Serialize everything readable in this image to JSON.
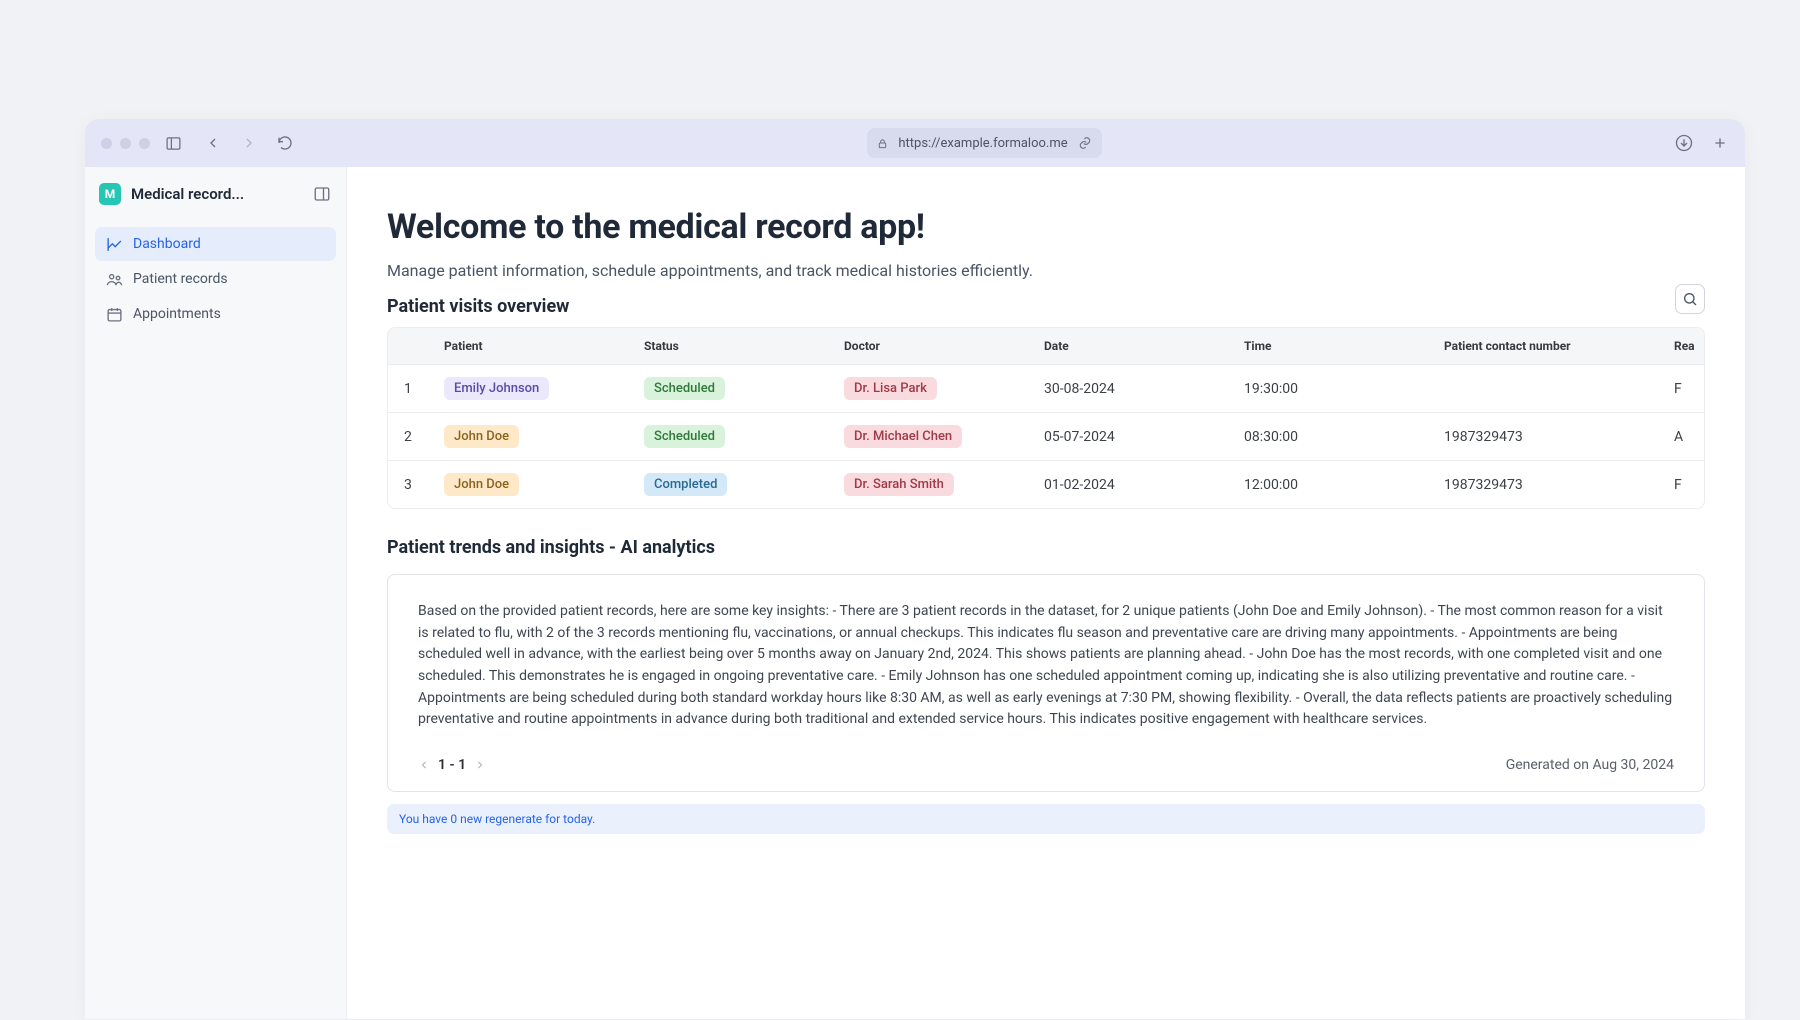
{
  "toolbar": {
    "url": "https://example.formaloo.me"
  },
  "sidebar": {
    "app_initial": "M",
    "app_title": "Medical record...",
    "items": [
      {
        "label": "Dashboard"
      },
      {
        "label": "Patient records"
      },
      {
        "label": "Appointments"
      }
    ]
  },
  "main": {
    "title": "Welcome to the medical record app!",
    "subtitle": "Manage patient information, schedule appointments, and track medical histories efficiently.",
    "visits_heading": "Patient visits overview",
    "columns": {
      "idx": "",
      "patient": "Patient",
      "status": "Status",
      "doctor": "Doctor",
      "date": "Date",
      "time": "Time",
      "contact": "Patient contact number",
      "reason": "Rea"
    },
    "rows": [
      {
        "idx": "1",
        "patient": "Emily Johnson",
        "patient_color": "purple",
        "status": "Scheduled",
        "status_color": "green",
        "doctor": "Dr. Lisa Park",
        "doctor_color": "pink",
        "date": "30-08-2024",
        "time": "19:30:00",
        "contact": "",
        "reason": "F"
      },
      {
        "idx": "2",
        "patient": "John Doe",
        "patient_color": "orange",
        "status": "Scheduled",
        "status_color": "green",
        "doctor": "Dr. Michael Chen",
        "doctor_color": "pink",
        "date": "05-07-2024",
        "time": "08:30:00",
        "contact": "1987329473",
        "reason": "A"
      },
      {
        "idx": "3",
        "patient": "John Doe",
        "patient_color": "orange",
        "status": "Completed",
        "status_color": "blue",
        "doctor": "Dr. Sarah Smith",
        "doctor_color": "pink",
        "date": "01-02-2024",
        "time": "12:00:00",
        "contact": "1987329473",
        "reason": "F"
      }
    ],
    "ai_heading": "Patient trends and insights - AI analytics",
    "ai_text": "Based on the provided patient records, here are some key insights: - There are 3 patient records in the dataset, for 2 unique patients (John Doe and Emily Johnson). - The most common reason for a visit is related to flu, with 2 of the 3 records mentioning flu, vaccinations, or annual checkups. This indicates flu season and preventative care are driving many appointments. - Appointments are being scheduled well in advance, with the earliest being over 5 months away on January 2nd, 2024. This shows patients are planning ahead. - John Doe has the most records, with one completed visit and one scheduled. This demonstrates he is engaged in ongoing preventative care. - Emily Johnson has one scheduled appointment coming up, indicating she is also utilizing preventative and routine care. - Appointments are being scheduled during both standard workday hours like 8:30 AM, as well as early evenings at 7:30 PM, showing flexibility. - Overall, the data reflects patients are proactively scheduling preventative and routine appointments in advance during both traditional and extended service hours. This indicates positive engagement with healthcare services.",
    "pager_range": "1 - 1",
    "generated_on": "Generated on Aug 30, 2024",
    "regen_banner": "You have 0 new regenerate for today."
  }
}
